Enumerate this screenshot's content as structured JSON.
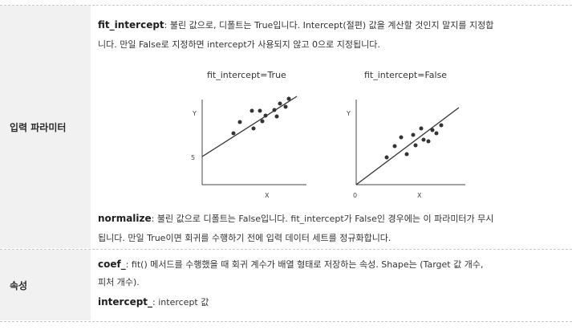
{
  "params_label": "입력 파라미터",
  "fit_intercept": {
    "term": "fit_intercept",
    "line1": ": 불린 값으로, 디폴트는 True입니다. Intercept(절편) 값을 계산할 것인지 말지를 지정합",
    "line2": "니다. 만일 False로 지정하면 intercept가 사용되지 않고 0으로 지정됩니다."
  },
  "charts": [
    {
      "title": "fit_intercept=True",
      "y_label": "Y",
      "x_label": "X",
      "intercept_label": "5"
    },
    {
      "title": "fit_intercept=False",
      "y_label": "Y",
      "x_label": "X",
      "origin_label": "0"
    }
  ],
  "normalize": {
    "term": "normalize",
    "line1": ": 불린 값으로 디폴트는 False입니다. fit_intercept가 False인 경우에는 이 파라미터가 무시",
    "line2": "됩니다. 만일 True이면 회귀를 수행하기 전에 입력 데이터 세트를 정규화합니다."
  },
  "attrs_label": "속성",
  "coef": {
    "term": "coef_",
    "line1": ": fit() 메서드를 수행했을 때 회귀 계수가 배열 형태로 저장하는 속성. Shape는 (Target 값 개수,",
    "line2": "피처 개수)."
  },
  "intercept": {
    "term": "intercept_",
    "line1": ": intercept 값"
  }
}
